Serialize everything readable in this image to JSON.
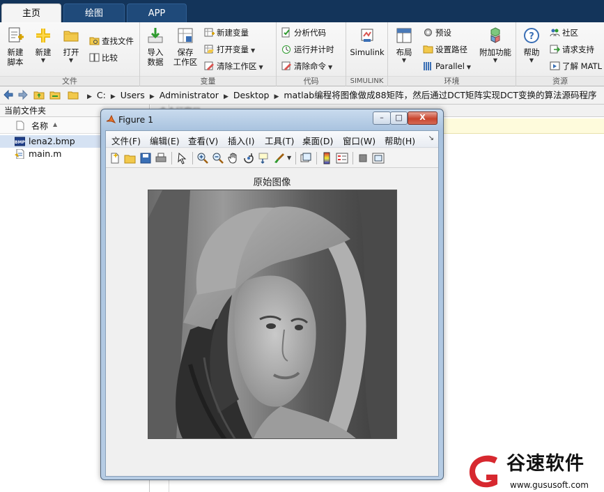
{
  "tabs": [
    {
      "label": "主页",
      "active": true
    },
    {
      "label": "绘图",
      "active": false
    },
    {
      "label": "APP",
      "active": false
    }
  ],
  "ribbon": {
    "file_group": {
      "label": "文件",
      "new_script": "新建\n脚本",
      "new": "新建",
      "open": "打开",
      "find_files": "查找文件",
      "compare": "比较"
    },
    "variable_group": {
      "label": "变量",
      "import_data": "导入\n数据",
      "save_workspace": "保存\n工作区",
      "new_variable": "新建变量",
      "open_variable": "打开变量",
      "clear_workspace": "清除工作区"
    },
    "code_group": {
      "label": "代码",
      "analyze_code": "分析代码",
      "run_and_time": "运行并计时",
      "clear_commands": "清除命令"
    },
    "simulink_group": {
      "label": "SIMULINK",
      "simulink": "Simulink"
    },
    "environment_group": {
      "label": "环境",
      "layout": "布局",
      "preferences": "预设",
      "set_path": "设置路径",
      "parallel": "Parallel",
      "addons": "附加功能"
    },
    "resources_group": {
      "label": "资源",
      "help": "帮助",
      "community": "社区",
      "request_support": "请求支持",
      "learn_matlab": "了解 MATL"
    }
  },
  "address": {
    "crumbs": [
      "C:",
      "Users",
      "Administrator",
      "Desktop",
      "matlab编程将图像做成88矩阵，然后通过DCT矩阵实现DCT变换的算法源码程序"
    ]
  },
  "current_folder": {
    "title": "当前文件夹",
    "column_name": "名称",
    "files": [
      {
        "name": "lena2.bmp",
        "selected": true,
        "icon": "bmp-file-icon"
      },
      {
        "name": "main.m",
        "selected": false,
        "icon": "m-file-icon"
      }
    ]
  },
  "command_window": {
    "title": "命令行窗口"
  },
  "figure": {
    "title": "Figure 1",
    "menus": [
      "文件(F)",
      "编辑(E)",
      "查看(V)",
      "插入(I)",
      "工具(T)",
      "桌面(D)",
      "窗口(W)",
      "帮助(H)"
    ],
    "axes_title": "原始图像",
    "minimize": "–",
    "maximize": "□",
    "close": "X"
  },
  "watermark": {
    "text": "谷速软件",
    "url": "www.gususoft.com"
  },
  "colors": {
    "tabbar": "#13345a",
    "selection": "#d5e2f3",
    "brand_red": "#d7282f"
  }
}
